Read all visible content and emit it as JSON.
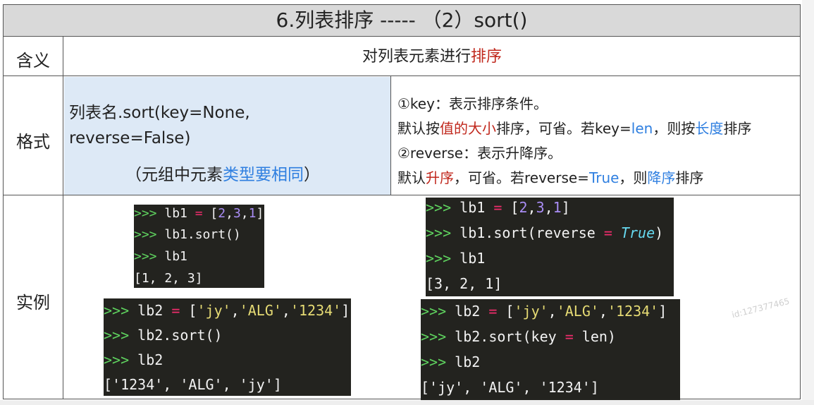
{
  "title": "6.列表排序    -----  （2）sort()",
  "rows": {
    "meaning_label": "含义",
    "format_label": "格式",
    "example_label": "实例"
  },
  "meaning": {
    "prefix": "对列表元素进行",
    "highlight": "排序"
  },
  "format_left": {
    "line1": "列表名.sort(key=None,",
    "line2": "reverse=False)",
    "line3_prefix": "（元组中元素",
    "line3_blue": "类型要相同",
    "line3_suffix": "）"
  },
  "format_right": {
    "l1": "①key：表示排序条件。",
    "l2_a": "默认按",
    "l2_red": "值的大小",
    "l2_b": "排序，可省。若key=",
    "l2_blue1": "len",
    "l2_c": "，则按",
    "l2_blue2": "长度",
    "l2_d": "排序",
    "l3": "②reverse：表示升降序。",
    "l4_a": "默认",
    "l4_red": "升序",
    "l4_b": "，可省。若reverse=",
    "l4_blue1": "True",
    "l4_c": "，则",
    "l4_blue2": "降序",
    "l4_d": "排序"
  },
  "code1": {
    "prompt": ">>> ",
    "l1_a": "lb1 ",
    "l1_op": "=",
    "l1_b": " [",
    "l1_n1": "2",
    "l1_c1": ",",
    "l1_n2": "3",
    "l1_c2": ",",
    "l1_n3": "1",
    "l1_e": "]",
    "l2": "lb1.sort()",
    "l3": "lb1",
    "out": "[1, 2, 3]"
  },
  "code2": {
    "prompt": ">>> ",
    "l1_a": "lb1 ",
    "l1_op": "=",
    "l1_b": " [",
    "l1_n1": "2",
    "l1_c1": ",",
    "l1_n2": "3",
    "l1_c2": ",",
    "l1_n3": "1",
    "l1_e": "]",
    "l2_a": "lb1.sort(reverse ",
    "l2_op": "=",
    "l2_sp": " ",
    "l2_kw": "True",
    "l2_e": ")",
    "l3": "lb1",
    "out": "[3, 2, 1]"
  },
  "code3": {
    "prompt": ">>> ",
    "l1_a": "lb2 ",
    "l1_op": "=",
    "l1_b": " [",
    "l1_s1": "'jy'",
    "l1_c1": ",",
    "l1_s2": "'ALG'",
    "l1_c2": ",",
    "l1_s3": "'1234'",
    "l1_e": "]",
    "l2": "lb2.sort()",
    "l3": "lb2",
    "out": "['1234', 'ALG', 'jy']"
  },
  "code4": {
    "prompt": ">>> ",
    "l1_a": "lb2 ",
    "l1_op": "=",
    "l1_b": " [",
    "l1_s1": "'jy'",
    "l1_c1": ",",
    "l1_s2": "'ALG'",
    "l1_c2": ",",
    "l1_s3": "'1234'",
    "l1_e": "]",
    "l2_a": "lb2.sort(key ",
    "l2_op": "=",
    "l2_b": " len)",
    "l3": "lb2",
    "out": "['jy', 'ALG', '1234']"
  },
  "watermark": "id:127377465",
  "colors": {
    "title_bg": "#d9d9d9",
    "format_bg": "#dde9f6",
    "red": "#c0271c",
    "blue": "#2f7fe0",
    "code_bg": "#23231f"
  }
}
